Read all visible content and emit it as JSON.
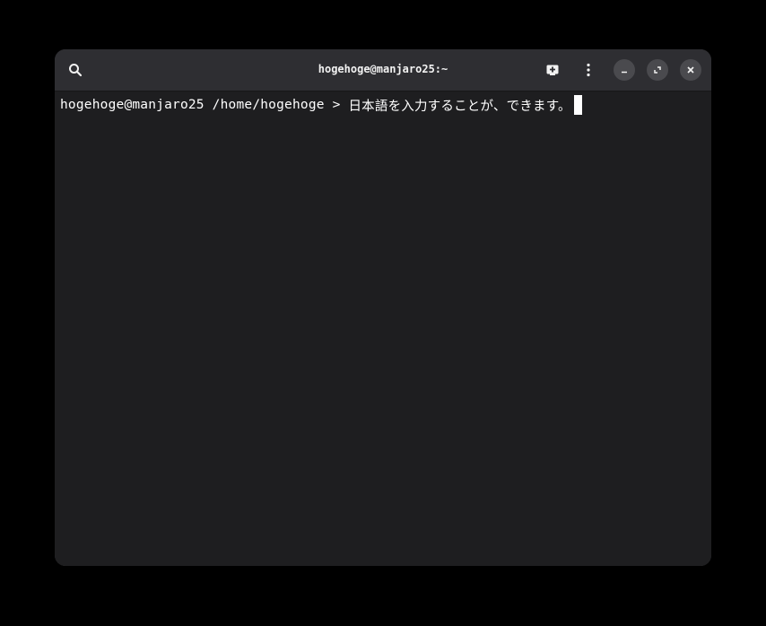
{
  "window": {
    "title": "hogehoge@manjaro25:~"
  },
  "headerbar": {
    "buttons": [
      {
        "name": "search",
        "icon": "search-icon"
      },
      {
        "name": "new-tab",
        "icon": "new-tab-icon"
      },
      {
        "name": "menu",
        "icon": "kebab-menu-icon"
      },
      {
        "name": "minimize",
        "icon": "minimize-icon"
      },
      {
        "name": "maximize",
        "icon": "maximize-icon"
      },
      {
        "name": "close",
        "icon": "close-icon"
      }
    ]
  },
  "terminal": {
    "prompt": "hogehoge@manjaro25 /home/hogehoge > ",
    "input": "日本語を入力することが、できます。"
  },
  "colors": {
    "background": "#000000",
    "window": "#1e1e20",
    "headerbar": "#2e2e32",
    "text": "#ffffff",
    "button": "#4a4a4e"
  }
}
